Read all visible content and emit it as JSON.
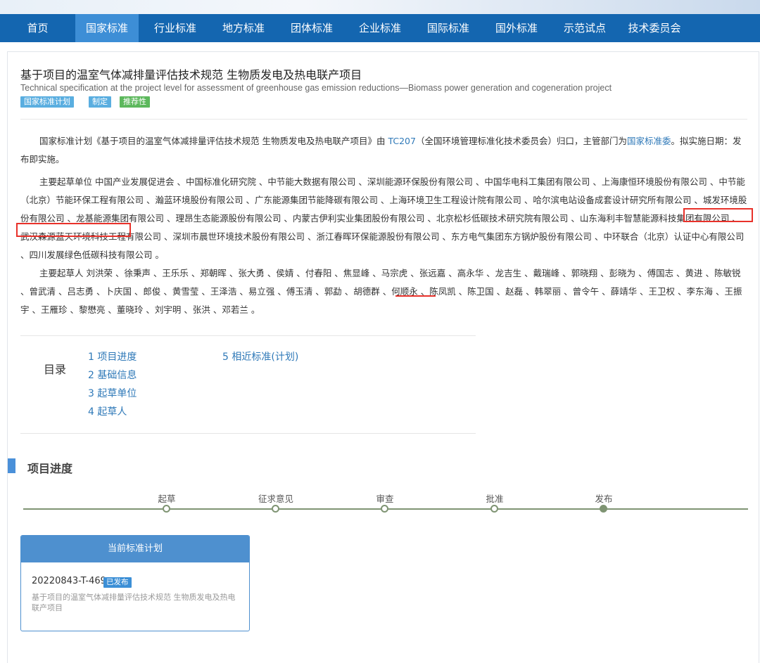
{
  "nav": {
    "items": [
      {
        "label": "首页"
      },
      {
        "label": "国家标准"
      },
      {
        "label": "行业标准"
      },
      {
        "label": "地方标准"
      },
      {
        "label": "团体标准"
      },
      {
        "label": "企业标准"
      },
      {
        "label": "国际标准"
      },
      {
        "label": "国外标准"
      },
      {
        "label": "示范试点"
      },
      {
        "label": "技术委员会"
      }
    ],
    "active_index": 1
  },
  "header": {
    "title_cn": "基于项目的温室气体减排量评估技术规范 生物质发电及热电联产项目",
    "title_en": "Technical specification at the project level for assessment of greenhouse gas emission reductions—Biomass power generation and cogeneration project",
    "tags": [
      "国家标准计划",
      "制定",
      "推荐性"
    ]
  },
  "intro": {
    "prefix": "国家标准计划《基于项目的温室气体减排量评估技术规范 生物质发电及热电联产项目》由 ",
    "tc_link": "TC207",
    "middle": "（全国环境管理标准化技术委员会）归口，主管部门为",
    "dept_link": "国家标准委",
    "suffix": "。拟实施日期：发布即实施。"
  },
  "drafting_units": {
    "text": "主要起草单位 中国产业发展促进会 、中国标准化研究院 、中节能大数据有限公司 、深圳能源环保股份有限公司 、中国华电科工集团有限公司 、上海康恒环境股份有限公司 、中节能（北京）节能环保工程有限公司 、瀚蓝环境股份有限公司 、广东能源集团节能降碳有限公司 、上海环境卫生工程设计院有限公司 、哈尔滨电站设备成套设计研究所有限公司 、城发环境股份有限公司 、龙基能源集团有限公司 、理昂生态能源股份有限公司 、内蒙古伊利实业集团股份有限公司 、北京松杉低碳技术研究院有限公司 、山东海利丰智慧能源科技集团有限公司 、武汉森源蓝天环境科技工程有限公司 、深圳市晨世环境技术股份有限公司 、浙江春晖环保能源股份有限公司 、东方电气集团东方锅炉股份有限公司 、中环联合（北京）认证中心有限公司 、四川发展绿色低碳科技有限公司 。"
  },
  "drafters": {
    "text": "主要起草人 刘洪荣 、徐秉声 、王乐乐 、郑朝晖 、张大勇 、侯婧 、付春阳 、焦显峰 、马宗虎 、张远嘉 、高永华 、龙吉生 、戴瑞峰 、郭晓翔 、彭晓为 、傅国志 、黄进 、陈敏锐 、曾武清 、吕志勇 、卜庆国 、郎俊 、黄雪莹 、王泽浩 、易立强 、傅玉清 、郭勐 、胡德群 、何顺永 、陈凤凯 、陈卫国 、赵磊 、韩翠丽 、曾令午 、薛靖华 、王卫权 、李东海 、王振宇 、王雁珍 、黎懋亮 、董晓玲 、刘宇明 、张洪 、邓若兰 。"
  },
  "toc": {
    "title": "目录",
    "items": [
      "1 项目进度",
      "2 基础信息",
      "3 起草单位",
      "4 起草人",
      "5 相近标准(计划)"
    ]
  },
  "progress": {
    "title": "项目进度",
    "stages": [
      "起草",
      "征求意见",
      "审查",
      "批准",
      "发布"
    ],
    "current_stage_index": 4
  },
  "card": {
    "header": "当前标准计划",
    "code": "20220843-T-469",
    "status": "已发布",
    "desc": "基于项目的温室气体减排量评估技术规范 生物质发电及热电联产项目"
  },
  "colors": {
    "nav_bg": "#1466b0",
    "nav_active": "#3d8ed6",
    "link": "#2f79b8",
    "highlight_red": "#e8312a",
    "timeline": "#7f9473",
    "tag_plan": "#5aaee0",
    "tag_formulate": "#5aaee0",
    "tag_recommend": "#5cb85c"
  }
}
